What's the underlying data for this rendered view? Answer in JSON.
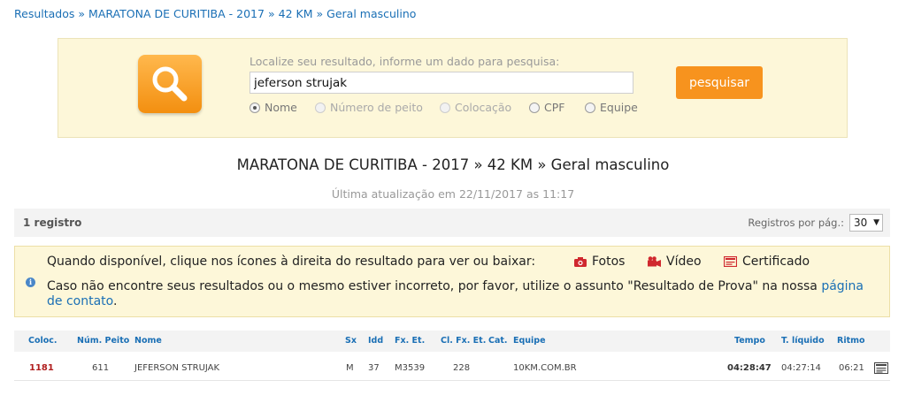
{
  "breadcrumb": {
    "items": [
      "Resultados",
      "MARATONA DE CURITIBA - 2017",
      "42 KM",
      "Geral masculino"
    ],
    "separator": "»"
  },
  "search": {
    "hint": "Localize seu resultado, informe um dado para pesquisa:",
    "value": "jeferson strujak",
    "button_label": "pesquisar",
    "options": [
      {
        "label": "Nome",
        "checked": true,
        "enabled": true
      },
      {
        "label": "Número de peito",
        "checked": false,
        "enabled": false
      },
      {
        "label": "Colocação",
        "checked": false,
        "enabled": false
      },
      {
        "label": "CPF",
        "checked": false,
        "enabled": true
      },
      {
        "label": "Equipe",
        "checked": false,
        "enabled": true
      }
    ]
  },
  "page": {
    "title": "MARATONA DE CURITIBA - 2017 » 42 KM » Geral masculino",
    "last_update": "Última atualização em 22/11/2017 as 11:17"
  },
  "records": {
    "count_label": "1 registro",
    "per_page_label": "Registros por pág.:",
    "per_page_value": "30"
  },
  "info": {
    "line1": "Quando disponível, clique nos ícones à direita do resultado para ver ou baixar:",
    "photos_label": "Fotos",
    "video_label": "Vídeo",
    "certificate_label": "Certificado",
    "line2_text": "Caso não encontre seus resultados ou o mesmo estiver incorreto, por favor, utilize o assunto \"Resultado de Prova\" na nossa",
    "contact_link": "página de contato",
    "line2_end": ".",
    "info_icon": "i"
  },
  "table": {
    "headers": [
      "Coloc.",
      "Núm. Peito",
      "Nome",
      "Sx",
      "Idd",
      "Fx. Et.",
      "Cl. Fx. Et.",
      "Cat.",
      "Equipe",
      "Tempo",
      "T. líquido",
      "Ritmo"
    ],
    "rows": [
      {
        "coloc": "1181",
        "num_peito": "611",
        "nome": "JEFERSON STRUJAK",
        "sx": "M",
        "idd": "37",
        "fx_et": "M3539",
        "cl_fx_et": "228",
        "cat": "",
        "equipe": "10KM.COM.BR",
        "tempo": "04:28:47",
        "t_liquido": "04:27:14",
        "ritmo": "06:21"
      }
    ]
  },
  "colors": {
    "link": "#1a6fb5",
    "accent": "#f7931e",
    "panel_bg": "#fdf7d9",
    "place": "#b01e1e",
    "media_icon": "#d0282e"
  },
  "icons": {
    "search_logo": "magnifier-icon",
    "photos": "camera-icon",
    "video": "video-camera-icon",
    "certificate": "certificate-icon",
    "row_action": "certificate-icon",
    "info": "info-icon"
  }
}
